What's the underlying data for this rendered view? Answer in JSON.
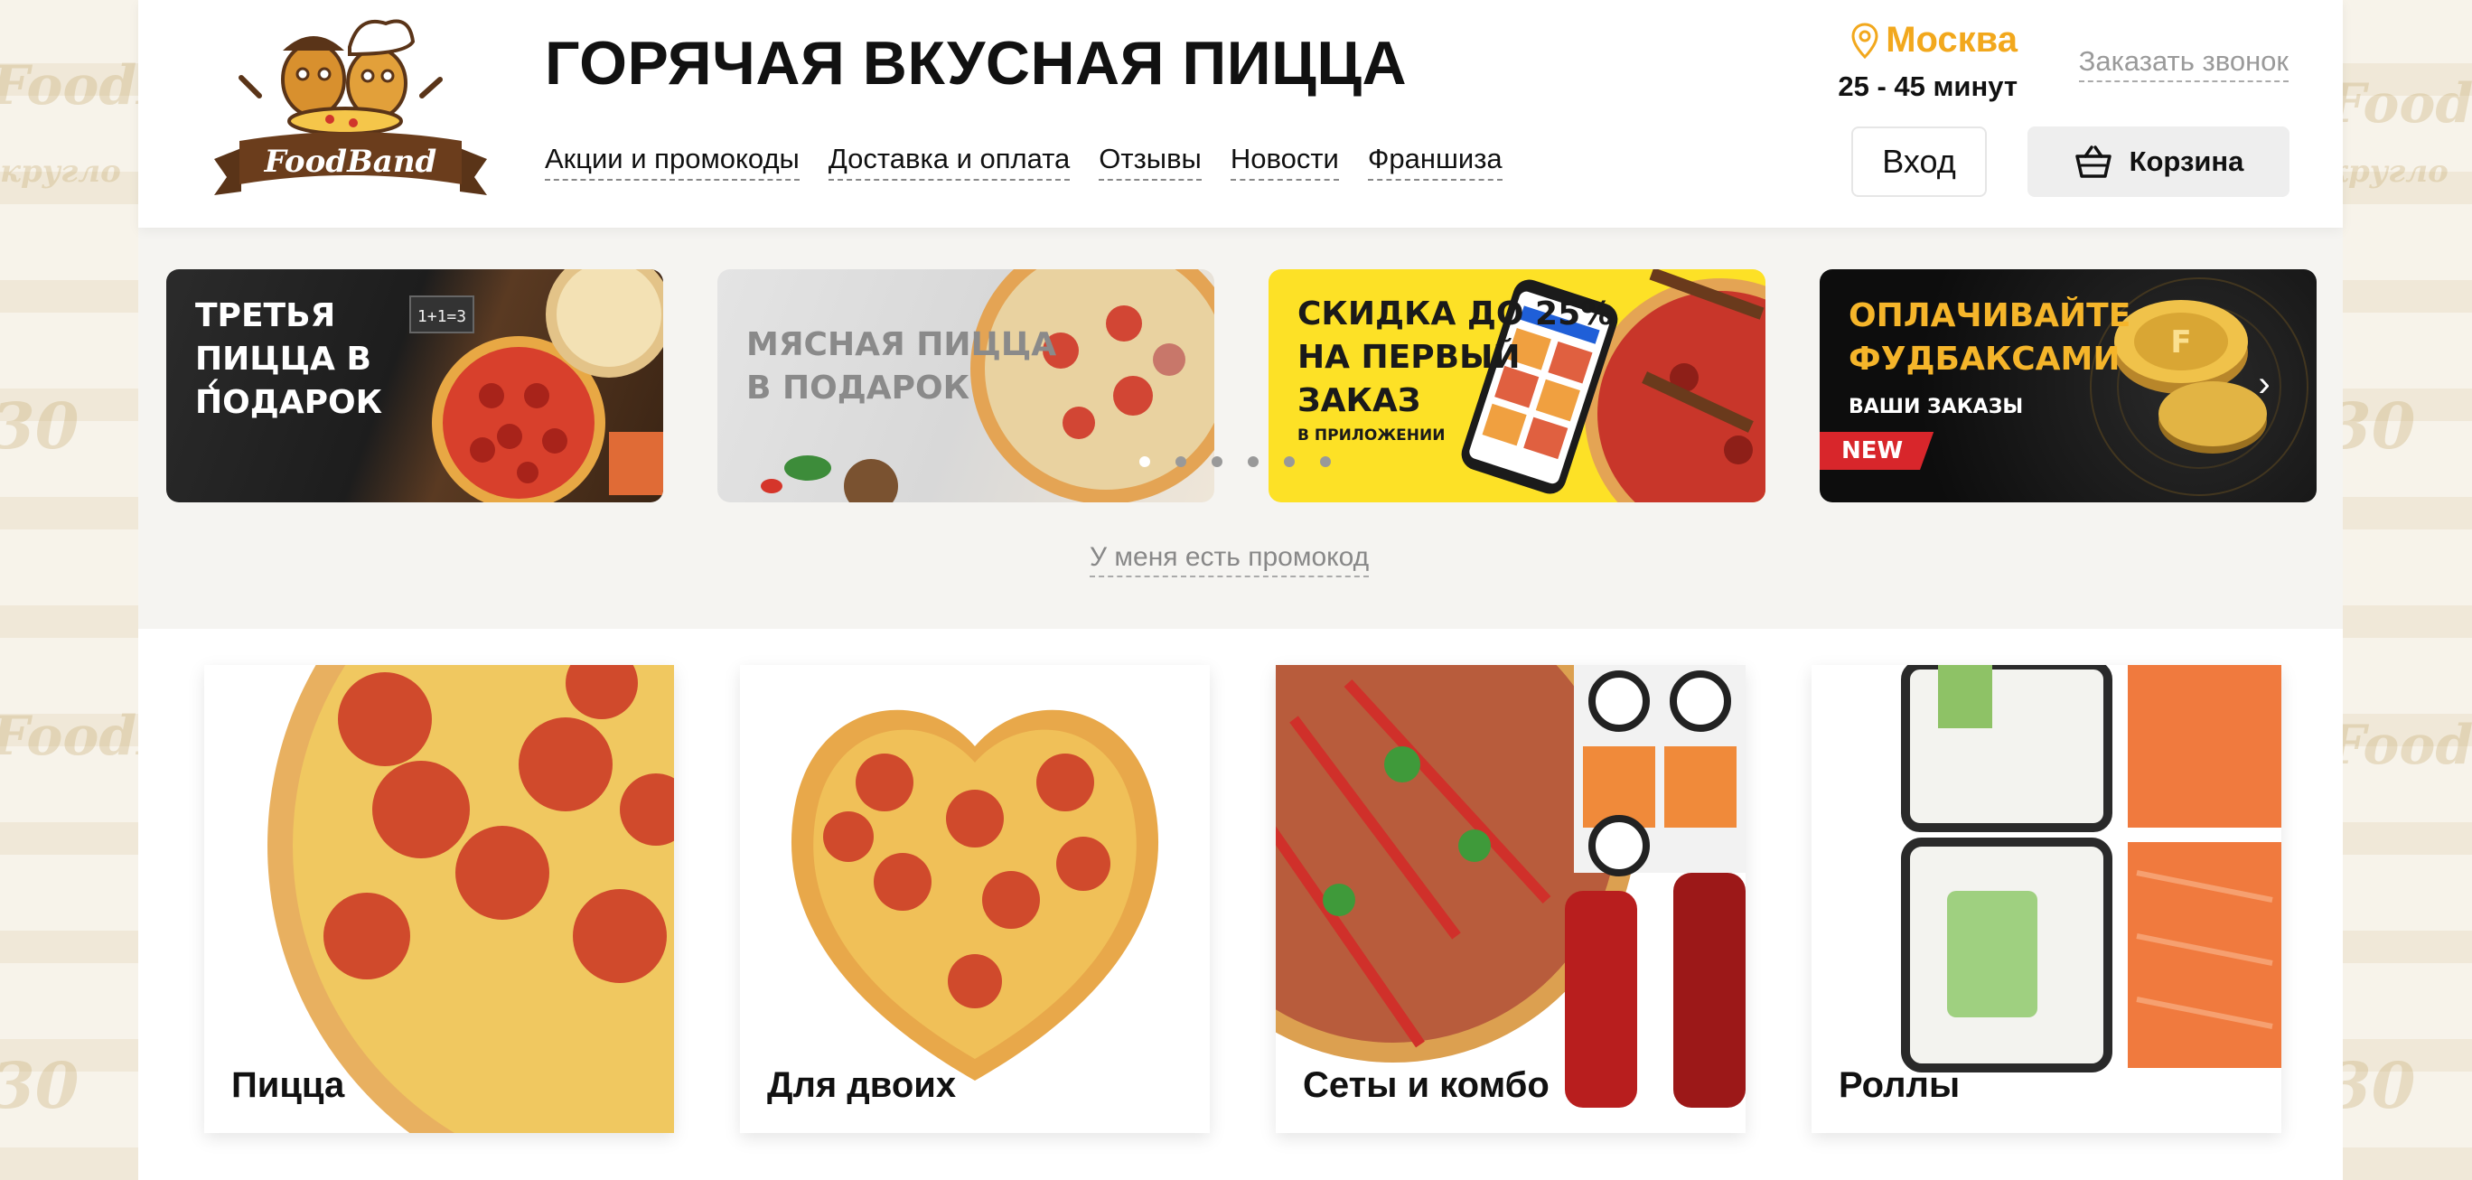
{
  "site": {
    "headline": "ГОРЯЧАЯ ВКУСНАЯ ПИЦЦА",
    "logo_text": "FoodBand"
  },
  "nav": {
    "items": [
      {
        "label": "Акции и промокоды"
      },
      {
        "label": "Доставка и оплата"
      },
      {
        "label": "Отзывы"
      },
      {
        "label": "Новости"
      },
      {
        "label": "Франшиза"
      }
    ]
  },
  "location": {
    "city": "Москва",
    "eta": "25 - 45 минут"
  },
  "header_actions": {
    "callback": "Заказать звонок",
    "login": "Вход",
    "cart": "Корзина"
  },
  "banners": [
    {
      "lines": [
        "Третья",
        "пицца в",
        "подарок"
      ],
      "equation": "1+1=3"
    },
    {
      "lines": [
        "Мясная пицца",
        "в подарок"
      ]
    },
    {
      "lines": [
        "Скидка до 25%",
        "на первый",
        "заказ"
      ],
      "small": "В ПРИЛОЖЕНИИ"
    },
    {
      "lines": [
        "Оплачивайте",
        "фудбаксами"
      ],
      "small": "ВАШИ ЗАКАЗЫ",
      "badge": "NEW"
    }
  ],
  "carousel": {
    "prev": "‹",
    "next": "›",
    "dots": 6,
    "active_dot": 0
  },
  "promo_link": "У меня есть промокод",
  "categories": [
    {
      "label": "Пицца"
    },
    {
      "label": "Для двоих"
    },
    {
      "label": "Сеты и комбо"
    },
    {
      "label": "Роллы"
    }
  ],
  "colors": {
    "accent": "#f2a81d",
    "brand_brown": "#5a3418",
    "banner_yellow": "#fde126",
    "badge_red": "#d8262b"
  },
  "icons": [
    "location-pin-icon",
    "basket-icon",
    "chevron-left-icon",
    "chevron-right-icon"
  ]
}
